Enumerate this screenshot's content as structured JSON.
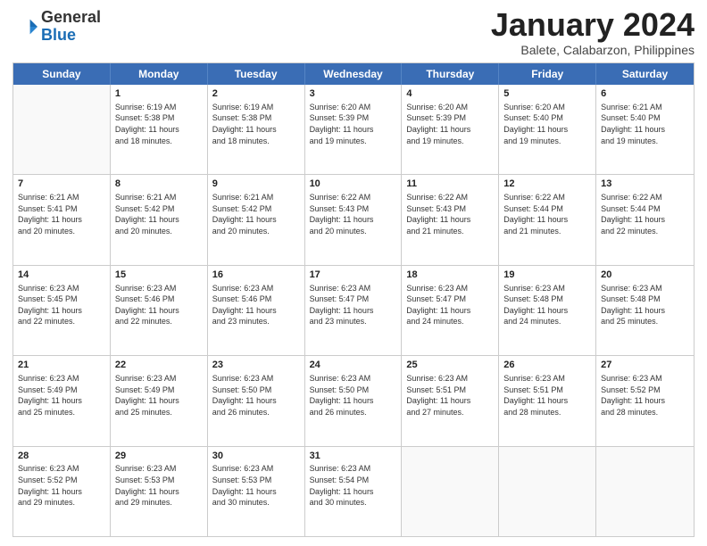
{
  "logo": {
    "general": "General",
    "blue": "Blue"
  },
  "title": {
    "month": "January 2024",
    "location": "Balete, Calabarzon, Philippines"
  },
  "days": [
    "Sunday",
    "Monday",
    "Tuesday",
    "Wednesday",
    "Thursday",
    "Friday",
    "Saturday"
  ],
  "weeks": [
    [
      {
        "day": "",
        "info": ""
      },
      {
        "day": "1",
        "info": "Sunrise: 6:19 AM\nSunset: 5:38 PM\nDaylight: 11 hours\nand 18 minutes."
      },
      {
        "day": "2",
        "info": "Sunrise: 6:19 AM\nSunset: 5:38 PM\nDaylight: 11 hours\nand 18 minutes."
      },
      {
        "day": "3",
        "info": "Sunrise: 6:20 AM\nSunset: 5:39 PM\nDaylight: 11 hours\nand 19 minutes."
      },
      {
        "day": "4",
        "info": "Sunrise: 6:20 AM\nSunset: 5:39 PM\nDaylight: 11 hours\nand 19 minutes."
      },
      {
        "day": "5",
        "info": "Sunrise: 6:20 AM\nSunset: 5:40 PM\nDaylight: 11 hours\nand 19 minutes."
      },
      {
        "day": "6",
        "info": "Sunrise: 6:21 AM\nSunset: 5:40 PM\nDaylight: 11 hours\nand 19 minutes."
      }
    ],
    [
      {
        "day": "7",
        "info": "Sunrise: 6:21 AM\nSunset: 5:41 PM\nDaylight: 11 hours\nand 20 minutes."
      },
      {
        "day": "8",
        "info": "Sunrise: 6:21 AM\nSunset: 5:42 PM\nDaylight: 11 hours\nand 20 minutes."
      },
      {
        "day": "9",
        "info": "Sunrise: 6:21 AM\nSunset: 5:42 PM\nDaylight: 11 hours\nand 20 minutes."
      },
      {
        "day": "10",
        "info": "Sunrise: 6:22 AM\nSunset: 5:43 PM\nDaylight: 11 hours\nand 20 minutes."
      },
      {
        "day": "11",
        "info": "Sunrise: 6:22 AM\nSunset: 5:43 PM\nDaylight: 11 hours\nand 21 minutes."
      },
      {
        "day": "12",
        "info": "Sunrise: 6:22 AM\nSunset: 5:44 PM\nDaylight: 11 hours\nand 21 minutes."
      },
      {
        "day": "13",
        "info": "Sunrise: 6:22 AM\nSunset: 5:44 PM\nDaylight: 11 hours\nand 22 minutes."
      }
    ],
    [
      {
        "day": "14",
        "info": "Sunrise: 6:23 AM\nSunset: 5:45 PM\nDaylight: 11 hours\nand 22 minutes."
      },
      {
        "day": "15",
        "info": "Sunrise: 6:23 AM\nSunset: 5:46 PM\nDaylight: 11 hours\nand 22 minutes."
      },
      {
        "day": "16",
        "info": "Sunrise: 6:23 AM\nSunset: 5:46 PM\nDaylight: 11 hours\nand 23 minutes."
      },
      {
        "day": "17",
        "info": "Sunrise: 6:23 AM\nSunset: 5:47 PM\nDaylight: 11 hours\nand 23 minutes."
      },
      {
        "day": "18",
        "info": "Sunrise: 6:23 AM\nSunset: 5:47 PM\nDaylight: 11 hours\nand 24 minutes."
      },
      {
        "day": "19",
        "info": "Sunrise: 6:23 AM\nSunset: 5:48 PM\nDaylight: 11 hours\nand 24 minutes."
      },
      {
        "day": "20",
        "info": "Sunrise: 6:23 AM\nSunset: 5:48 PM\nDaylight: 11 hours\nand 25 minutes."
      }
    ],
    [
      {
        "day": "21",
        "info": "Sunrise: 6:23 AM\nSunset: 5:49 PM\nDaylight: 11 hours\nand 25 minutes."
      },
      {
        "day": "22",
        "info": "Sunrise: 6:23 AM\nSunset: 5:49 PM\nDaylight: 11 hours\nand 25 minutes."
      },
      {
        "day": "23",
        "info": "Sunrise: 6:23 AM\nSunset: 5:50 PM\nDaylight: 11 hours\nand 26 minutes."
      },
      {
        "day": "24",
        "info": "Sunrise: 6:23 AM\nSunset: 5:50 PM\nDaylight: 11 hours\nand 26 minutes."
      },
      {
        "day": "25",
        "info": "Sunrise: 6:23 AM\nSunset: 5:51 PM\nDaylight: 11 hours\nand 27 minutes."
      },
      {
        "day": "26",
        "info": "Sunrise: 6:23 AM\nSunset: 5:51 PM\nDaylight: 11 hours\nand 28 minutes."
      },
      {
        "day": "27",
        "info": "Sunrise: 6:23 AM\nSunset: 5:52 PM\nDaylight: 11 hours\nand 28 minutes."
      }
    ],
    [
      {
        "day": "28",
        "info": "Sunrise: 6:23 AM\nSunset: 5:52 PM\nDaylight: 11 hours\nand 29 minutes."
      },
      {
        "day": "29",
        "info": "Sunrise: 6:23 AM\nSunset: 5:53 PM\nDaylight: 11 hours\nand 29 minutes."
      },
      {
        "day": "30",
        "info": "Sunrise: 6:23 AM\nSunset: 5:53 PM\nDaylight: 11 hours\nand 30 minutes."
      },
      {
        "day": "31",
        "info": "Sunrise: 6:23 AM\nSunset: 5:54 PM\nDaylight: 11 hours\nand 30 minutes."
      },
      {
        "day": "",
        "info": ""
      },
      {
        "day": "",
        "info": ""
      },
      {
        "day": "",
        "info": ""
      }
    ]
  ]
}
